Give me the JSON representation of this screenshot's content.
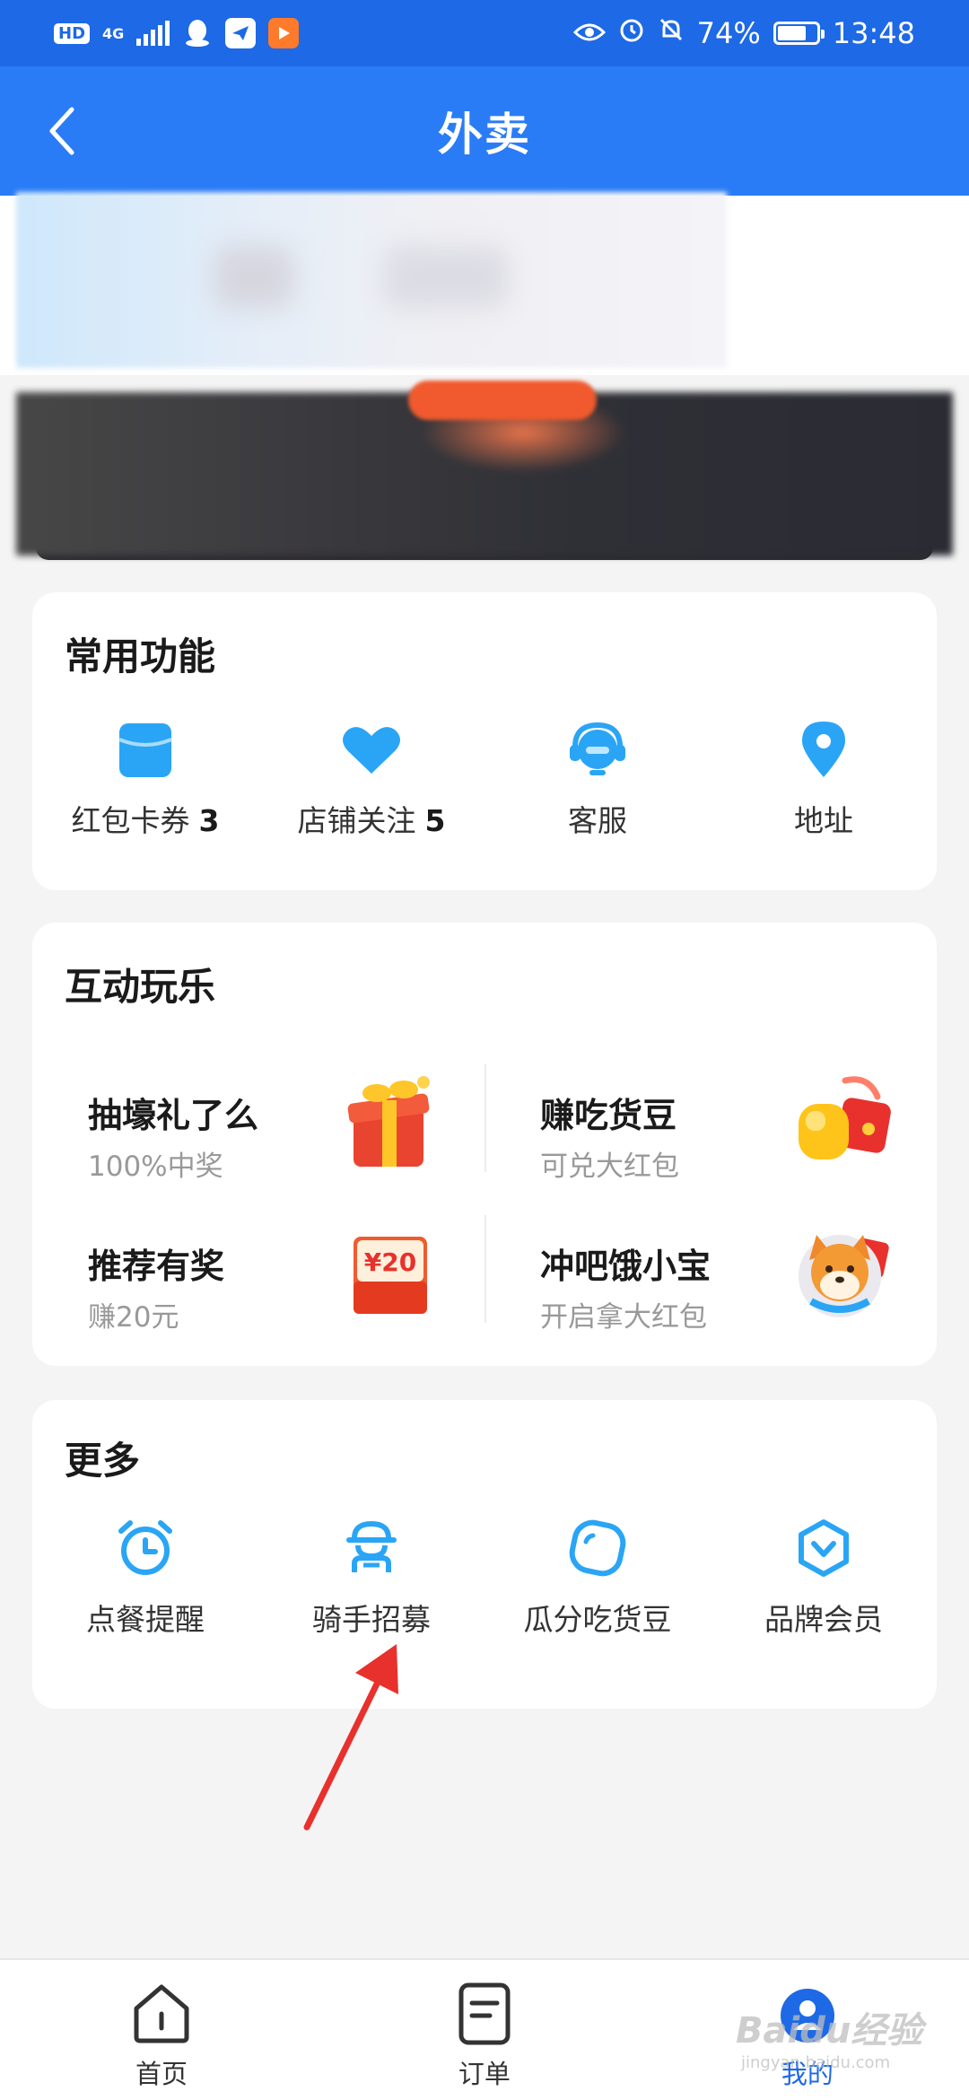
{
  "status_bar": {
    "hd": "HD",
    "network": "4G",
    "battery": "74%",
    "battery_level": 0.74,
    "time": "13:48"
  },
  "header": {
    "title": "外卖",
    "back_icon": "chevron-left-icon"
  },
  "common_functions": {
    "title": "常用功能",
    "items": [
      {
        "label": "红包卡券",
        "count": "3",
        "icon": "coupon-icon"
      },
      {
        "label": "店铺关注",
        "count": "5",
        "icon": "heart-icon"
      },
      {
        "label": "客服",
        "count": "",
        "icon": "headset-icon"
      },
      {
        "label": "地址",
        "count": "",
        "icon": "location-pin-icon"
      }
    ]
  },
  "interactive_fun": {
    "title": "互动玩乐",
    "items": [
      {
        "title": "抽壕礼了么",
        "subtitle": "100%中奖",
        "icon": "gift-box-icon"
      },
      {
        "title": "赚吃货豆",
        "subtitle": "可兑大红包",
        "icon": "bean-red-packet-icon"
      },
      {
        "title": "推荐有奖",
        "subtitle": "赚20元",
        "icon": "red-envelope-icon",
        "badge": "¥20"
      },
      {
        "title": "冲吧饿小宝",
        "subtitle": "开启拿大红包",
        "icon": "mascot-dog-icon"
      }
    ]
  },
  "more": {
    "title": "更多",
    "items": [
      {
        "label": "点餐提醒",
        "icon": "alarm-clock-icon"
      },
      {
        "label": "骑手招募",
        "icon": "rider-icon"
      },
      {
        "label": "瓜分吃货豆",
        "icon": "bean-icon"
      },
      {
        "label": "品牌会员",
        "icon": "shield-badge-icon"
      }
    ]
  },
  "tabbar": {
    "tabs": [
      {
        "label": "首页",
        "icon": "home-icon"
      },
      {
        "label": "订单",
        "icon": "order-icon"
      },
      {
        "label": "我的",
        "icon": "profile-icon"
      }
    ],
    "active_index": 2
  },
  "watermark": {
    "text": "Baidu经验",
    "sub": "jingyan.baidu.com"
  },
  "colors": {
    "status_bar": "#1d69e6",
    "header": "#2a7cf6",
    "accent": "#2aa5f5",
    "background": "#f4f4f4",
    "arrow": "#e8312d"
  }
}
